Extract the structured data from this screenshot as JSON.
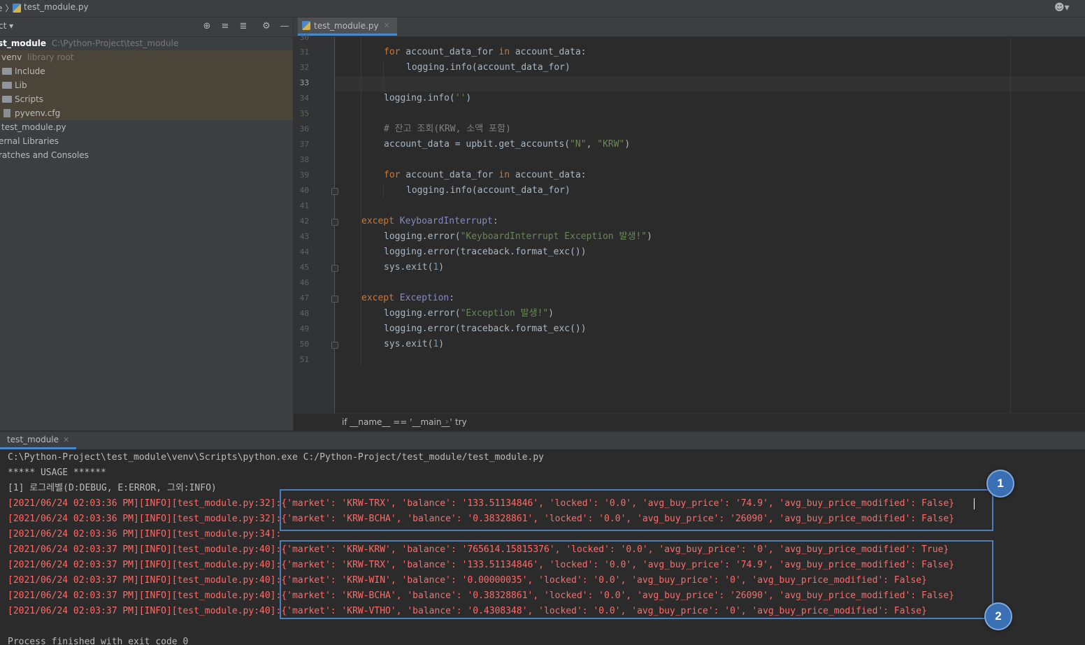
{
  "titlebar": {
    "breadcrumb_prefix": "e 〉",
    "file_name": "test_module.py"
  },
  "project_panel": {
    "title": "ct",
    "tree": [
      {
        "label": "st_module",
        "path": "C:\\Python-Project\\test_module"
      },
      {
        "label": "venv",
        "note": "library root"
      },
      {
        "label": "Include"
      },
      {
        "label": "Lib"
      },
      {
        "label": "Scripts"
      },
      {
        "label": "pyvenv.cfg"
      },
      {
        "label": "test_module.py"
      },
      {
        "label": "ernal Libraries"
      },
      {
        "label": "ratches and Consoles"
      }
    ]
  },
  "editor": {
    "tab_label": "test_module.py",
    "line_numbers": [
      "30",
      "31",
      "32",
      "33",
      "34",
      "35",
      "36",
      "37",
      "38",
      "39",
      "40",
      "41",
      "42",
      "43",
      "44",
      "45",
      "46",
      "47",
      "48",
      "49",
      "50",
      "51"
    ],
    "code": {
      "l31_kw1": "for",
      "l31_mid": " account_data_for ",
      "l31_kw2": "in",
      "l31_end": " account_data:",
      "l32": "logging.info(account_data_for)",
      "l34_a": "logging.info(",
      "l34_s": "''",
      "l34_b": ")",
      "l36": "# 잔고 조회(KRW, 소액 포함)",
      "l37_a": "account_data = upbit.get_accounts(",
      "l37_s1": "\"N\"",
      "l37_c": ", ",
      "l37_s2": "\"KRW\"",
      "l37_b": ")",
      "l39_kw1": "for",
      "l39_mid": " account_data_for ",
      "l39_kw2": "in",
      "l39_end": " account_data:",
      "l40": "logging.info(account_data_for)",
      "l42_kw": "except",
      "l42_cls": "KeyboardInterrupt",
      "l42_end": ":",
      "l43_a": "logging.error(",
      "l43_s": "\"KeyboardInterrupt Exception 발생!\"",
      "l43_b": ")",
      "l44": "logging.error(traceback.format_exc())",
      "l45_a": "sys.exit(",
      "l45_n": "1",
      "l45_b": ")",
      "l47_kw": "except",
      "l47_cls": "Exception",
      "l47_end": ":",
      "l48_a": "logging.error(",
      "l48_s": "\"Exception 발생!\"",
      "l48_b": ")",
      "l49": "logging.error(traceback.format_exc())",
      "l50_a": "sys.exit(",
      "l50_n": "1",
      "l50_b": ")"
    },
    "breadcrumb": {
      "item1": "if __name__ == '__main__'",
      "sep": "›",
      "item2": "try"
    }
  },
  "run_panel": {
    "tab_label": "test_module",
    "lines": [
      "C:\\Python-Project\\test_module\\venv\\Scripts\\python.exe C:/Python-Project/test_module/test_module.py",
      "***** USAGE ******",
      "[1] 로그레벨(D:DEBUG, E:ERROR, 그외:INFO)",
      "[2021/06/24 02:03:36 PM][INFO][test_module.py:32]:{'market': 'KRW-TRX', 'balance': '133.51134846', 'locked': '0.0', 'avg_buy_price': '74.9', 'avg_buy_price_modified': False}",
      "[2021/06/24 02:03:36 PM][INFO][test_module.py:32]:{'market': 'KRW-BCHA', 'balance': '0.38328861', 'locked': '0.0', 'avg_buy_price': '26090', 'avg_buy_price_modified': False}",
      "[2021/06/24 02:03:36 PM][INFO][test_module.py:34]:",
      "[2021/06/24 02:03:37 PM][INFO][test_module.py:40]:{'market': 'KRW-KRW', 'balance': '765614.15815376', 'locked': '0.0', 'avg_buy_price': '0', 'avg_buy_price_modified': True}",
      "[2021/06/24 02:03:37 PM][INFO][test_module.py:40]:{'market': 'KRW-TRX', 'balance': '133.51134846', 'locked': '0.0', 'avg_buy_price': '74.9', 'avg_buy_price_modified': False}",
      "[2021/06/24 02:03:37 PM][INFO][test_module.py:40]:{'market': 'KRW-WIN', 'balance': '0.00000035', 'locked': '0.0', 'avg_buy_price': '0', 'avg_buy_price_modified': False}",
      "[2021/06/24 02:03:37 PM][INFO][test_module.py:40]:{'market': 'KRW-BCHA', 'balance': '0.38328861', 'locked': '0.0', 'avg_buy_price': '26090', 'avg_buy_price_modified': False}",
      "[2021/06/24 02:03:37 PM][INFO][test_module.py:40]:{'market': 'KRW-VTHO', 'balance': '0.4308348', 'locked': '0.0', 'avg_buy_price': '0', 'avg_buy_price_modified': False}",
      "",
      "Process finished with exit code 0"
    ]
  },
  "annotations": {
    "badge1": "1",
    "badge2": "2",
    "box_color": "#4a7fbf"
  },
  "colors": {
    "keyword": "#cc7832",
    "string": "#6a8759",
    "number": "#6897bb",
    "comment": "#808080",
    "log_red": "#ff6b68"
  }
}
